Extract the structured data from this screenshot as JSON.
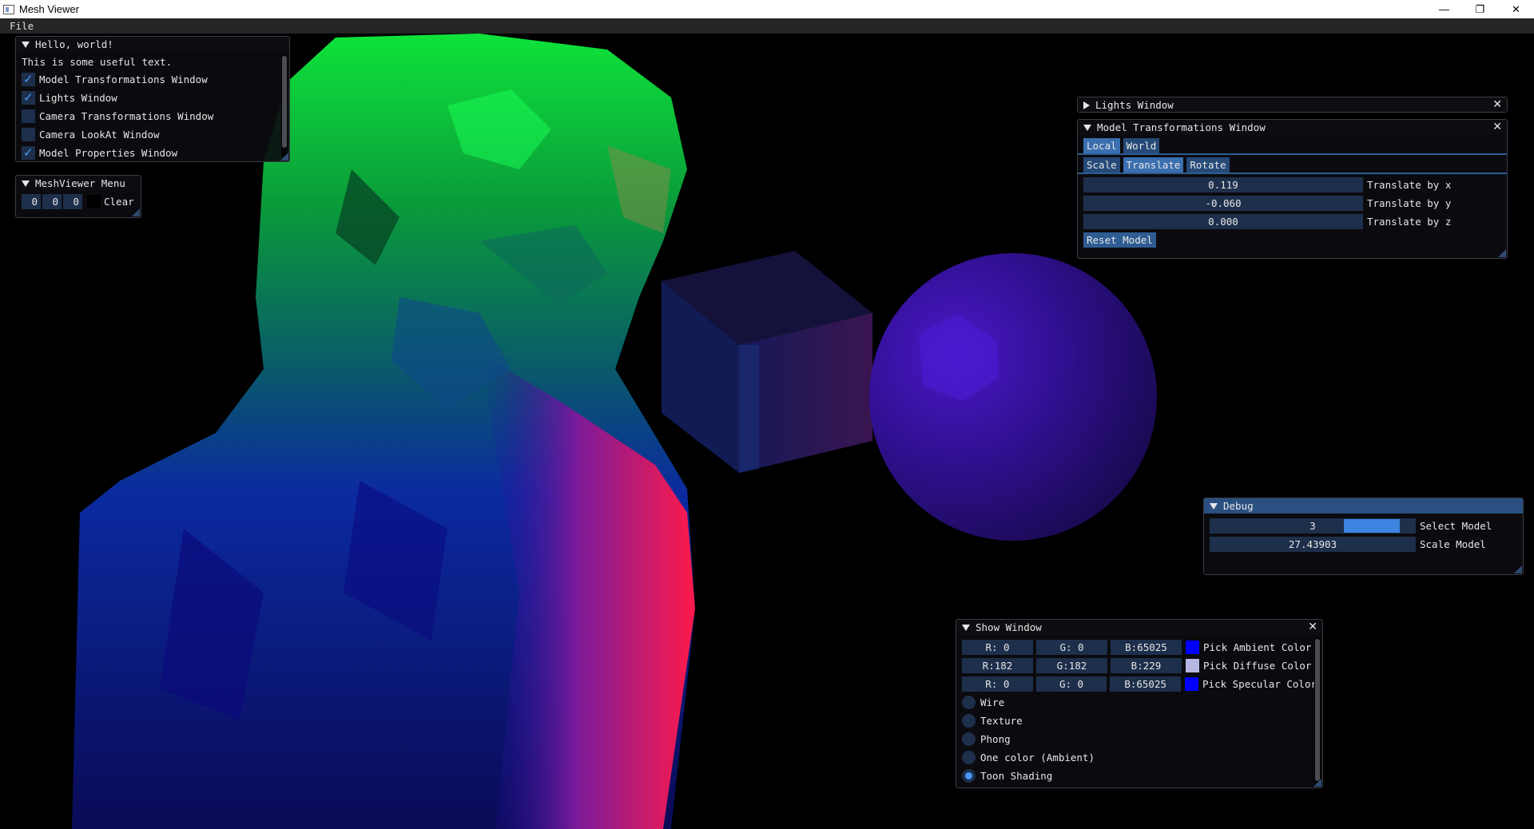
{
  "window": {
    "title": "Mesh Viewer",
    "controls": [
      "—",
      "❐",
      "✕"
    ]
  },
  "menubar": {
    "file_label": "File"
  },
  "hello": {
    "title": "Hello, world!",
    "text": "This is some useful text.",
    "items": [
      {
        "label": "Model Transformations Window",
        "checked": true
      },
      {
        "label": "Lights Window",
        "checked": true
      },
      {
        "label": "Camera Transformations Window",
        "checked": false
      },
      {
        "label": "Camera LookAt Window",
        "checked": false
      },
      {
        "label": "Model Properties Window",
        "checked": true
      }
    ]
  },
  "meshmenu": {
    "title": "MeshViewer Menu",
    "values": [
      "0",
      "0",
      "0"
    ],
    "clear_label": "Clear"
  },
  "lights": {
    "title": "Lights Window"
  },
  "model_tf": {
    "title": "Model Transformations Window",
    "space_tabs": [
      "Local",
      "World"
    ],
    "op_tabs": [
      "Scale",
      "Translate",
      "Rotate"
    ],
    "active_op": "Translate",
    "rows": [
      {
        "value": "0.119",
        "label": "Translate by x"
      },
      {
        "value": "-0.060",
        "label": "Translate by y"
      },
      {
        "value": "0.000",
        "label": "Translate by z"
      }
    ],
    "reset_label": "Reset Model"
  },
  "debug": {
    "title": "Debug",
    "select_value": "3",
    "select_label": "Select Model",
    "select_fill": 0.35,
    "scale_value": "27.43903",
    "scale_label": "Scale Model"
  },
  "show": {
    "title": "Show Window",
    "colors": [
      {
        "r": "R:  0",
        "g": "G:  0",
        "b": "B:65025",
        "label": "Pick Ambient Color",
        "swatch": "#0000ff"
      },
      {
        "r": "R:182",
        "g": "G:182",
        "b": "B:229",
        "label": "Pick Diffuse Color",
        "swatch": "#b6b6e5"
      },
      {
        "r": "R:  0",
        "g": "G:  0",
        "b": "B:65025",
        "label": "Pick Specular Color",
        "swatch": "#0000ff"
      }
    ],
    "modes": [
      {
        "label": "Wire",
        "on": false
      },
      {
        "label": "Texture",
        "on": false
      },
      {
        "label": "Phong",
        "on": false
      },
      {
        "label": "One color (Ambient)",
        "on": false
      },
      {
        "label": "Toon Shading",
        "on": true
      }
    ]
  },
  "colors": {
    "title_active": "#295080",
    "frame_bg": "#1d2f4b",
    "button": "#2e5c92",
    "check": "#4a9af5"
  }
}
